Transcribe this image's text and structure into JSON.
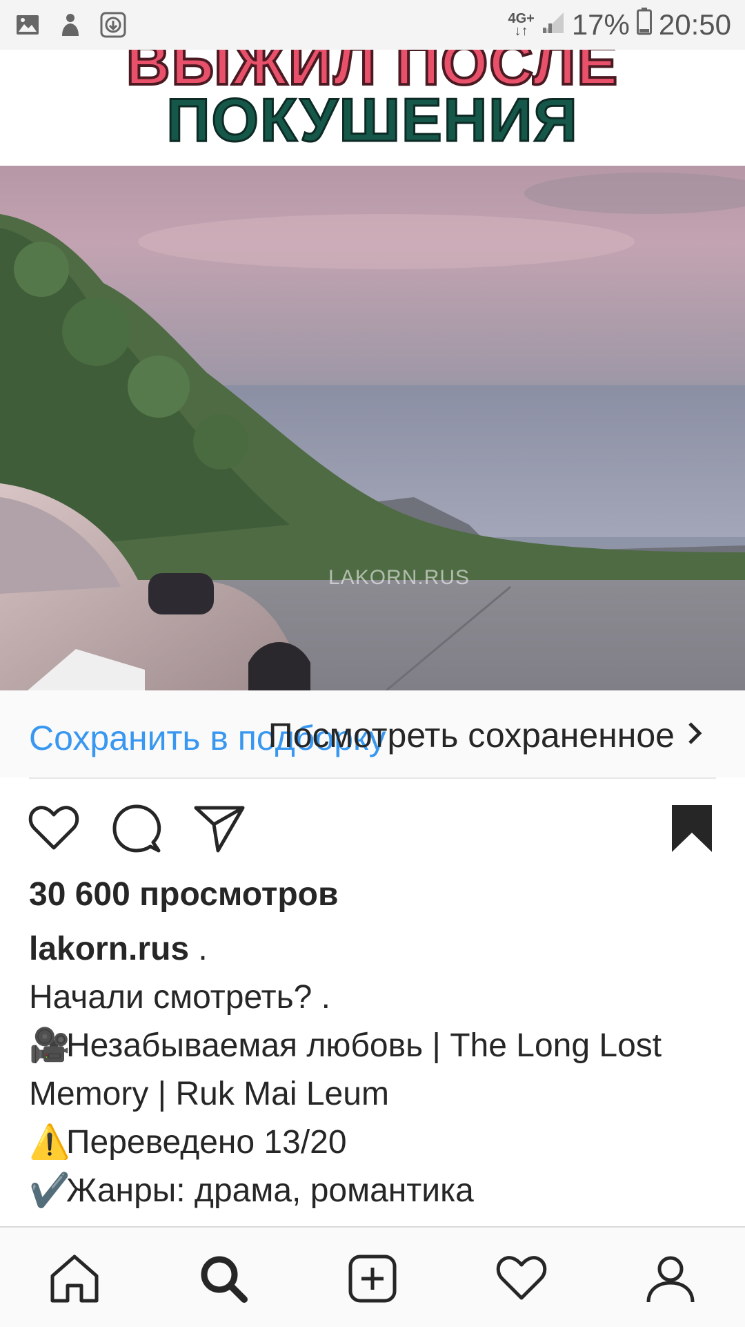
{
  "status_bar": {
    "network_top": "4G+",
    "network_bottom": "↓↑",
    "battery_percent": "17%",
    "time": "20:50",
    "icons": [
      "image-icon",
      "app-icon",
      "download-icon",
      "signal-icon",
      "battery-icon"
    ]
  },
  "media": {
    "title_line1": "ВЫЖИЛ ПОСЛЕ",
    "title_line2": "ПОКУШЕНИЯ",
    "watermark": "LAKORN.RUS"
  },
  "save_bar": {
    "save_to_collection": "Сохранить в подборку",
    "view_saved": "Посмотреть сохраненное"
  },
  "actions": {
    "icons": [
      "heart-icon",
      "comment-icon",
      "send-icon",
      "bookmark-icon"
    ],
    "bookmark_filled": true
  },
  "post": {
    "views": "30 600 просмотров",
    "username": "lakorn.rus",
    "username_suffix": " .",
    "lines": [
      "Начали смотреть? .",
      "Незабываемая любовь | The Long Lost Memory | Ruk Mai Leum",
      "Переведено 13/20",
      "Жанры: драма, романтика"
    ],
    "line_emojis": [
      "",
      "🎥",
      "⚠️",
      "✔️"
    ]
  },
  "bottom_nav": {
    "items": [
      "home-icon",
      "search-icon",
      "new-post-icon",
      "activity-icon",
      "profile-icon"
    ],
    "active": "search-icon"
  },
  "colors": {
    "link_blue": "#3897f0",
    "text": "#262626",
    "title_pink": "#e9516b",
    "title_green": "#15584a"
  }
}
